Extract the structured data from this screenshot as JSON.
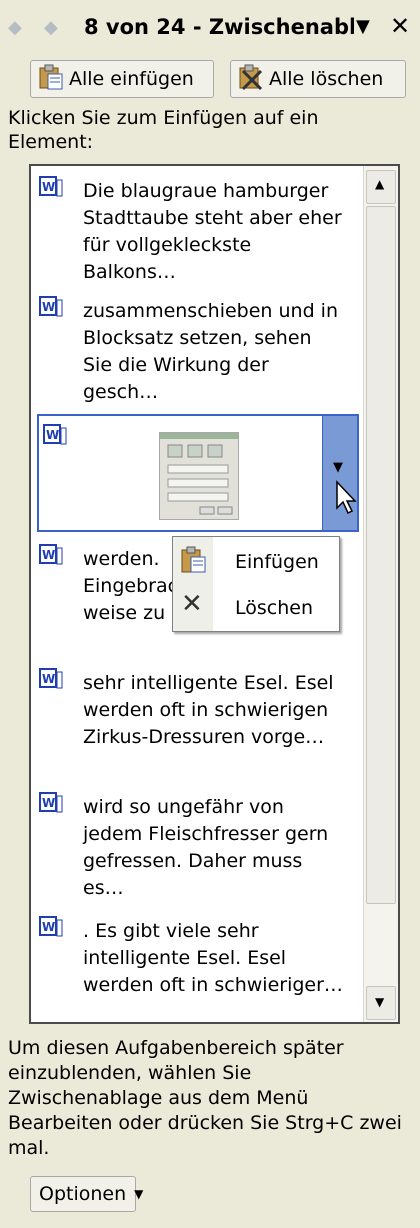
{
  "title": {
    "text": "8 von 24 - Zwischenabl",
    "back_icon": "back-arrow-icon",
    "forward_icon": "forward-arrow-icon",
    "menu_icon": "dropdown-triangle-icon",
    "close_icon": "close-icon"
  },
  "toolbar": {
    "paste_all_label": "Alle einfügen",
    "clear_all_label": "Alle löschen"
  },
  "instruction": "Klicken Sie zum Einfügen auf ein Element:",
  "clipboard_items": [
    {
      "type": "word-document",
      "text": "Die blaugraue hamburger Stadttaube steht aber eher für vollgekleckste Balkons…"
    },
    {
      "type": "word-document",
      "text": "zusammenschieben und in Blocksatz setzen, sehen Sie die Wirkung der gesch…"
    },
    {
      "type": "word-image",
      "text": ""
    },
    {
      "type": "word-document",
      "text": "werden. Eingebrac weise zu"
    },
    {
      "type": "word-document",
      "text": "sehr intelligente Esel. Esel werden oft in schwierigen Zirkus-Dressuren vorge…"
    },
    {
      "type": "word-document",
      "text": "wird so ungefähr von jedem Fleischfresser gern gefressen. Daher muss es…"
    },
    {
      "type": "word-document",
      "text": ". Es gibt viele sehr intelligente Esel. Esel werden oft in schwieriger…"
    }
  ],
  "context_menu": {
    "paste_label": "Einfügen",
    "delete_label": "Löschen"
  },
  "footer": "Um diesen Aufgabenbereich später einzublenden, wählen Sie Zwischenablage aus dem Menü Bearbeiten oder drücken Sie Strg+C zwei mal.",
  "options_label": "Optionen",
  "colors": {
    "panel_bg": "#ebe9d7",
    "selection_border": "#3c63c8",
    "dropdown_fill": "#7a9ad6",
    "word_icon_blue": "#1f3fb0"
  }
}
